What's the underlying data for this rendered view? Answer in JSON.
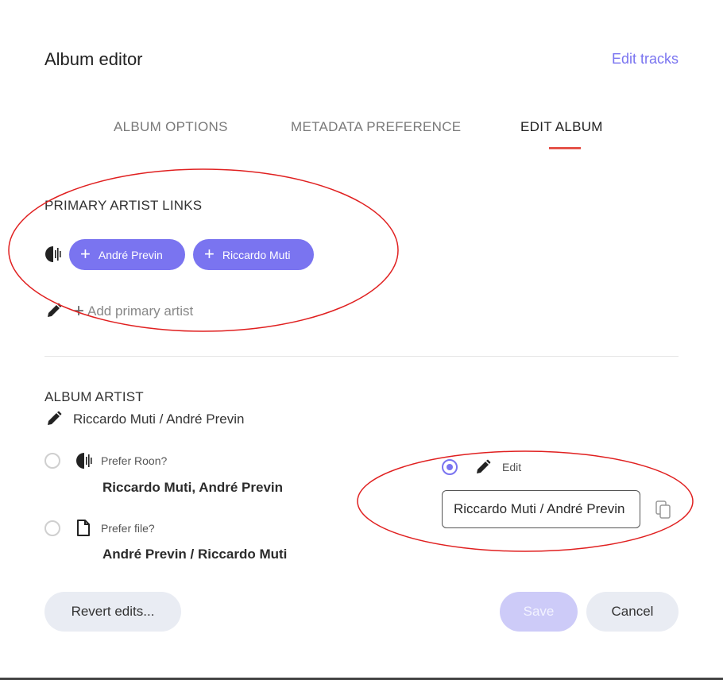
{
  "dialog": {
    "title": "Album editor",
    "edit_tracks_link": "Edit tracks"
  },
  "tabs": [
    {
      "label": "ALBUM OPTIONS",
      "active": false
    },
    {
      "label": "METADATA PREFERENCE",
      "active": false
    },
    {
      "label": "EDIT ALBUM",
      "active": true
    }
  ],
  "primary_artist_links": {
    "heading": "PRIMARY ARTIST LINKS",
    "source_icon": "roon-icon",
    "artists": [
      {
        "name": "André Previn"
      },
      {
        "name": "Riccardo Muti"
      }
    ],
    "add_label": "Add primary artist"
  },
  "album_artist": {
    "heading": "ALBUM ARTIST",
    "current_value": "Riccardo Muti / André Previn",
    "options": {
      "roon": {
        "label": "Prefer Roon?",
        "value": "Riccardo Muti, André Previn",
        "selected": false
      },
      "file": {
        "label": "Prefer file?",
        "value": "André Previn / Riccardo Muti",
        "selected": false
      },
      "edit": {
        "label": "Edit",
        "value": "Riccardo Muti / André Previn",
        "selected": true
      }
    }
  },
  "footer": {
    "revert_label": "Revert edits...",
    "save_label": "Save",
    "cancel_label": "Cancel"
  },
  "colors": {
    "accent": "#7a74f0",
    "tab_indicator": "#e5534b",
    "annotation_ellipse": "#e02020"
  }
}
